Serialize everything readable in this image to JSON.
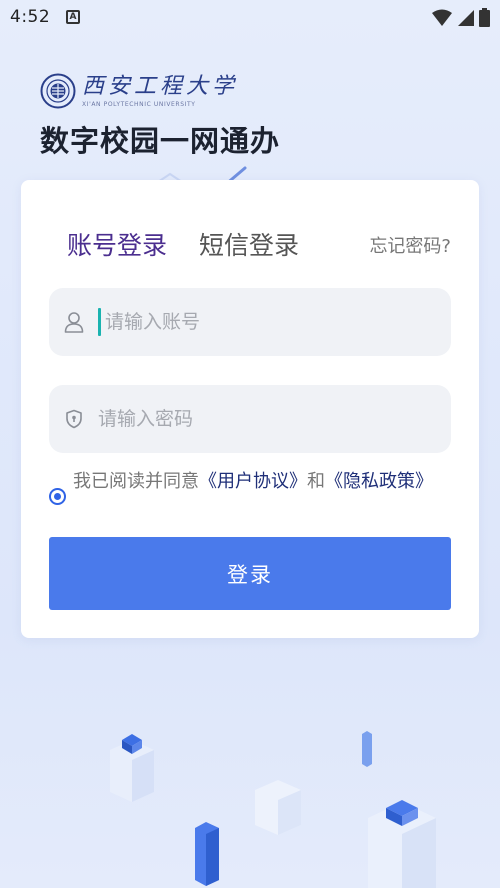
{
  "status_bar": {
    "time": "4:52",
    "notif_letter": "A"
  },
  "header": {
    "university_name_cn": "西安工程大学",
    "university_name_en": "XI'AN POLYTECHNIC UNIVERSITY",
    "title": "数字校园一网通办"
  },
  "login": {
    "tabs": [
      {
        "label": "账号登录",
        "active": true
      },
      {
        "label": "短信登录",
        "active": false
      }
    ],
    "forgot_label": "忘记密码?",
    "account_placeholder": "请输入账号",
    "password_placeholder": "请输入密码",
    "agreement": {
      "checked": true,
      "prefix": "我已阅读并同意",
      "user_agreement": "《用户协议》",
      "connector": "和",
      "privacy_policy": "《隐私政策》"
    },
    "submit_label": "登录"
  },
  "colors": {
    "primary": "#4a7aeb",
    "active_tab": "#4b2e8f",
    "link": "#1f2f78",
    "radio": "#2f63e6",
    "caret": "#1ab3b0"
  },
  "icons": [
    "wifi-icon",
    "signal-icon",
    "battery-icon",
    "user-icon",
    "shield-icon",
    "university-seal-icon"
  ]
}
